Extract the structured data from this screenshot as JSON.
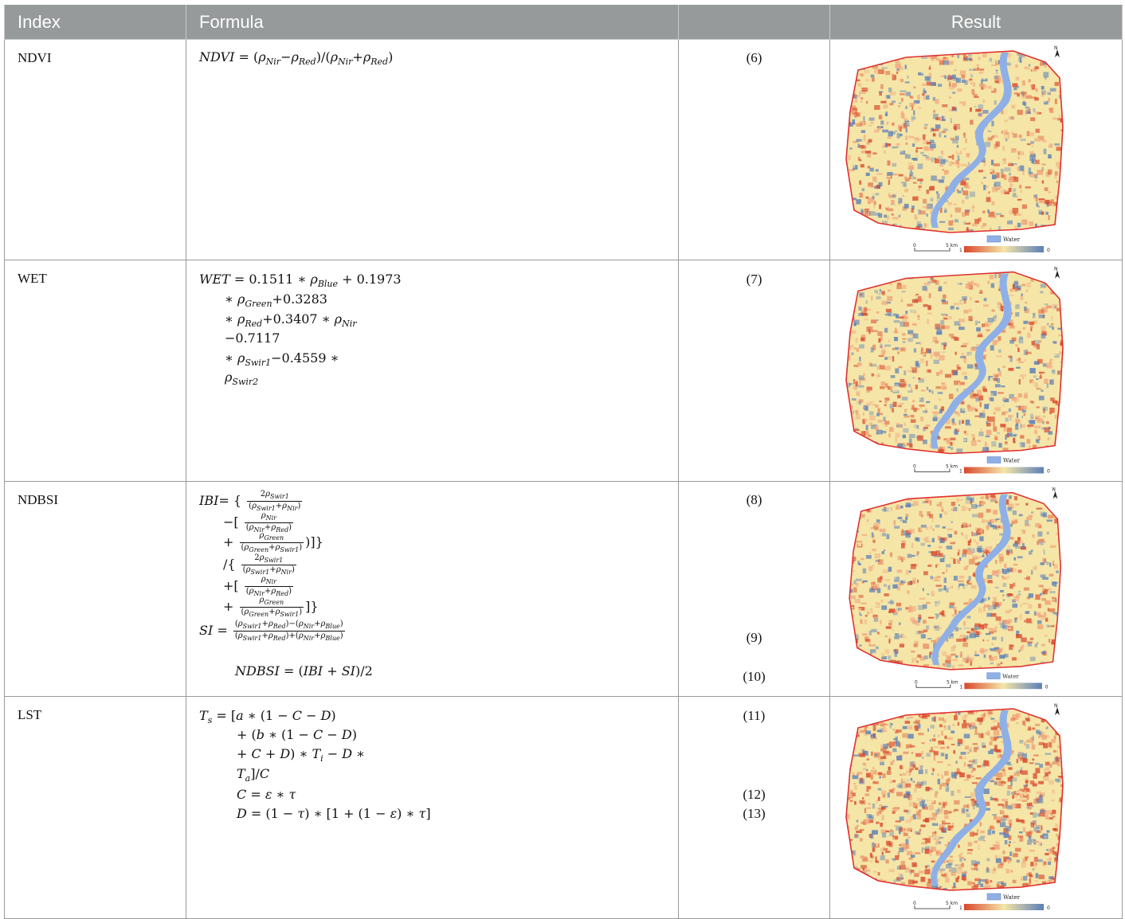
{
  "header": {
    "index": "Index",
    "formula": "Formula",
    "eqno": "",
    "result": "Result"
  },
  "rows": [
    {
      "index": "NDVI",
      "eq": [
        "(6)"
      ]
    },
    {
      "index": "WET",
      "eq": [
        "(7)"
      ]
    },
    {
      "index": "NDBSI",
      "eq": [
        "(8)",
        "(9)",
        "(10)"
      ]
    },
    {
      "index": "LST",
      "eq": [
        "(11)",
        "(12)",
        "(13)"
      ]
    }
  ],
  "map_legend": {
    "water": "Water",
    "scale_zero": "0",
    "scale_km": "5 km",
    "range_max": "1",
    "range_min": "0",
    "north": "N"
  },
  "colors": {
    "header_bg": "#979a9a",
    "water": "#8fb0e6",
    "boundary": "#e03030",
    "high": "#d9472b",
    "mid": "#f5e6a8",
    "low": "#5b7fb8"
  }
}
